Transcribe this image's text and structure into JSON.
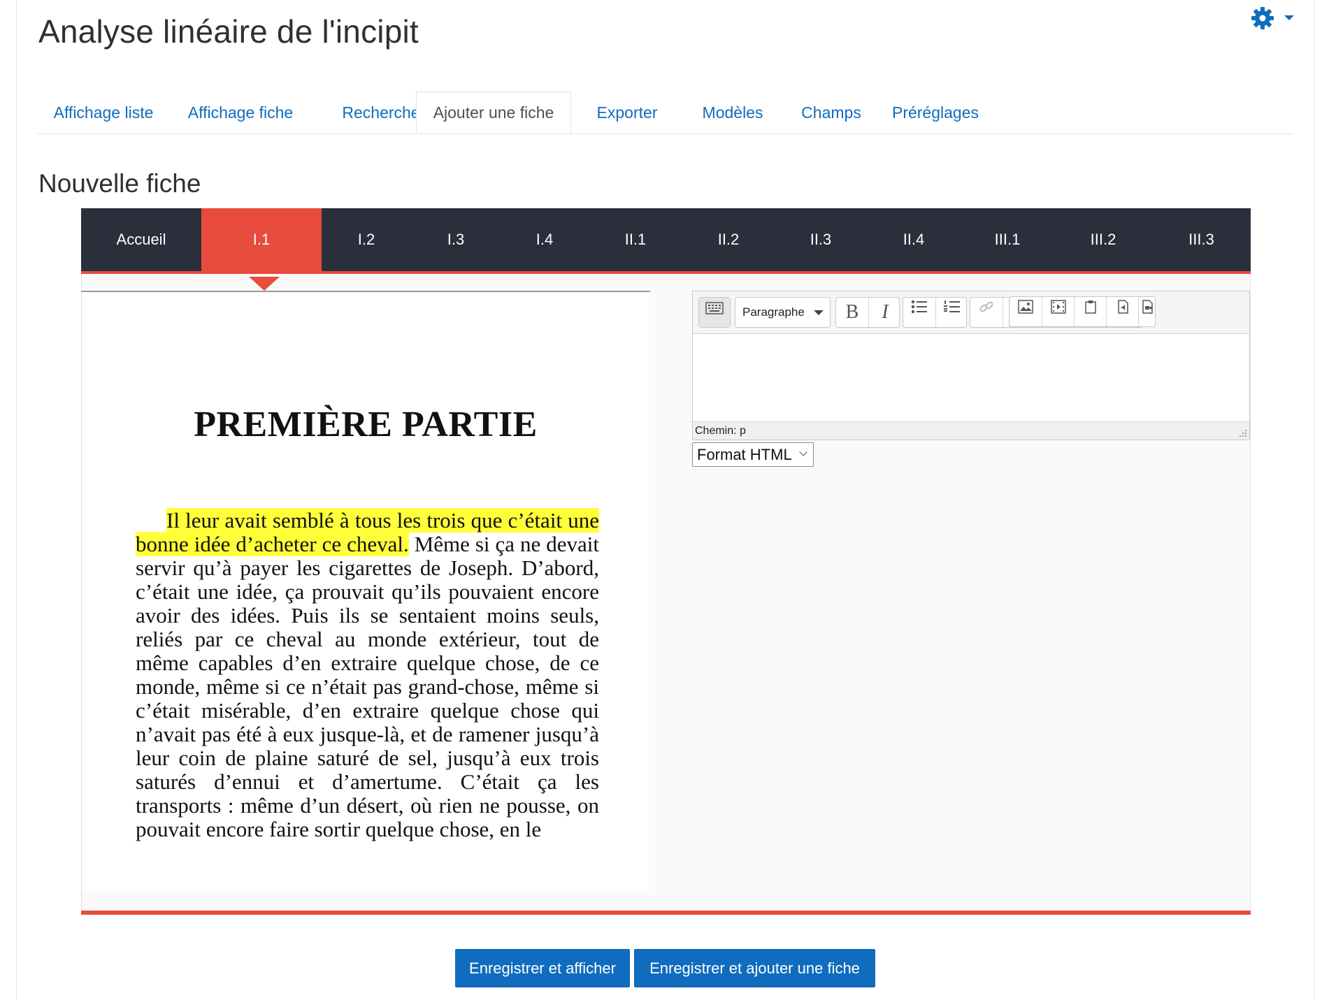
{
  "header": {
    "title": "Analyse linéaire de l'incipit"
  },
  "tabs": [
    {
      "label": "Affichage liste"
    },
    {
      "label": "Affichage fiche"
    },
    {
      "label": "Recherche"
    },
    {
      "label": "Ajouter une fiche",
      "active": true
    },
    {
      "label": "Exporter"
    },
    {
      "label": "Modèles"
    },
    {
      "label": "Champs"
    },
    {
      "label": "Préréglages"
    }
  ],
  "section": {
    "title": "Nouvelle fiche"
  },
  "pager": {
    "items": [
      "Accueil",
      "I.1",
      "I.2",
      "I.3",
      "I.4",
      "II.1",
      "II.2",
      "II.3",
      "II.4",
      "III.1",
      "III.2",
      "III.3"
    ],
    "active": "I.1"
  },
  "document": {
    "heading": "PREMIÈRE PARTIE",
    "highlighted": "Il leur avait semblé à tous les trois que c’était une bonne idée d’acheter ce cheval.",
    "rest": " Même si ça ne devait servir qu’à payer les cigarettes de Joseph. D’abord, c’était une idée, ça prouvait qu’ils pouvaient encore avoir des idées. Puis ils se sentaient moins seuls, reliés par ce cheval au monde extérieur, tout de même capables d’en extraire quelque chose, de ce monde, même si ce n’était pas grand-chose, même si c’était misérable, d’en extraire quelque chose qui n’avait pas été à eux jusque-là, et de ramener jusqu’à leur coin de plaine saturé de sel, jusqu’à eux trois saturés d’ennui et d’amertume. C’était ça les transports : même d’un désert, où rien ne pousse, on pouvait encore faire sortir quelque chose, en le"
  },
  "editor": {
    "block_format": "Paragraphe",
    "bold_label": "B",
    "italic_label": "I",
    "path_text": "Chemin: p",
    "format_value": "Format HTML"
  },
  "actions": {
    "save_display": "Enregistrer et afficher",
    "save_add": "Enregistrer et ajouter une fiche"
  },
  "colors": {
    "accent": "#0f6cbf",
    "pager_bg": "#2a2f3b",
    "pager_active": "#e74c3c",
    "highlight": "#ffff3a"
  }
}
